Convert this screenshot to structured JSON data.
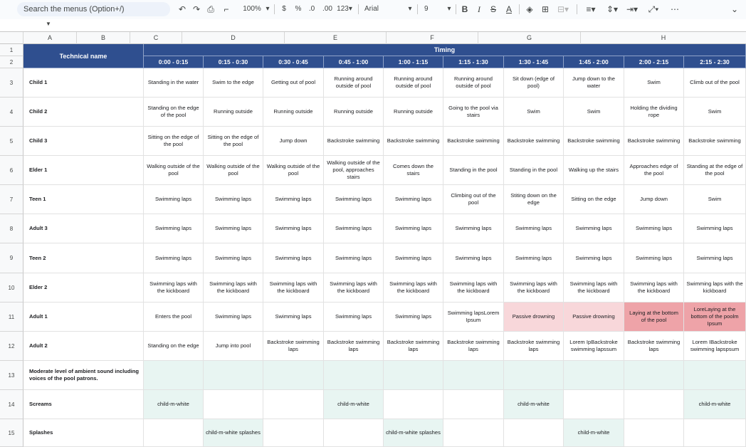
{
  "toolbar": {
    "search_placeholder": "Search the menus (Option+/)",
    "zoom": "100%",
    "currency": "$",
    "percent": "%",
    "dec_decrease": ".0",
    "dec_increase": ".00",
    "format_more": "123",
    "font": "Arial",
    "font_size": "9",
    "bold": "B",
    "italic": "I",
    "strike": "S",
    "text_color": "A",
    "more": "⋯"
  },
  "columns": [
    "A",
    "B",
    "C",
    "D",
    "E",
    "F",
    "G",
    "H"
  ],
  "header": {
    "technical_name": "Technical name",
    "timing": "Timing",
    "times": [
      "0:00 - 0:15",
      "0:15 - 0:30",
      "0:30 - 0:45",
      "0:45 - 1:00",
      "1:00 - 1:15",
      "1:15 - 1:30",
      "1:30 - 1:45",
      "1:45 - 2:00",
      "2:00 - 2:15",
      "2:15 - 2:30"
    ]
  },
  "row_numbers": [
    "1",
    "2",
    "3",
    "4",
    "5",
    "6",
    "7",
    "8",
    "9",
    "10",
    "11",
    "12",
    "13",
    "14",
    "15"
  ],
  "rows": [
    {
      "name": "Child 1",
      "cells": [
        "Standing in the water",
        "Swim to the edge",
        "Getting out of pool",
        "Running around outside of pool",
        "Running around outside of pool",
        "Running around outside of pool",
        "Sit down (edge of pool)",
        "Jump down to the water",
        "Swim",
        "Climb out of the pool"
      ]
    },
    {
      "name": "Child 2",
      "cells": [
        "Standing on the edge of the pool",
        "Running outside",
        "Running outside",
        "Running outside",
        "Running outside",
        "Going to the pool via stairs",
        "Swim",
        "Swim",
        "Holding the dividing rope",
        "Swim"
      ]
    },
    {
      "name": "Child 3",
      "cells": [
        "Sitting on the edge of the pool",
        "Sitting on the edge of the pool",
        "Jump down",
        "Backstroke swimming",
        "Backstroke swimming",
        "Backstroke swimming",
        "Backstroke swimming",
        "Backstroke swimming",
        "Backstroke swimming",
        "Backstroke swimming"
      ]
    },
    {
      "name": "Elder 1",
      "cells": [
        "Walking outside of the pool",
        "Walking outside of the pool",
        "Walking outside of the pool",
        "Walking outside of the pool, approaches stairs",
        "Comes down the stairs",
        "Standing in the pool",
        "Standing in the pool",
        "Walking up the stairs",
        "Approaches edge of the pool",
        "Standing at the edge of the pool"
      ]
    },
    {
      "name": "Teen 1",
      "cells": [
        "Swimming laps",
        "Swimming laps",
        "Swimming laps",
        "Swimming laps",
        "Swimming laps",
        "Climbing out of the pool",
        "Stiting down on the edge",
        "Sitting on the edge",
        "Jump down",
        "Swim"
      ]
    },
    {
      "name": "Adult 3",
      "cells": [
        "Swimming laps",
        "Swimming laps",
        "Swimming laps",
        "Swimming laps",
        "Swimming laps",
        "Swimming laps",
        "Swimming laps",
        "Swimming laps",
        "Swimming laps",
        "Swimming laps"
      ]
    },
    {
      "name": "Teen 2",
      "cells": [
        "Swimming laps",
        "Swimming laps",
        "Swimming laps",
        "Swimming laps",
        "Swimming laps",
        "Swimming laps",
        "Swimming laps",
        "Swimming laps",
        "Swimming laps",
        "Swimming laps"
      ]
    },
    {
      "name": "Elder 2",
      "cells": [
        "Swimming laps with the kickboard",
        "Swimming laps with the kickboard",
        "Swimming laps with the kickboard",
        "Swimming laps with the kickboard",
        "Swimming laps with the kickboard",
        "Swimming laps with the kickboard",
        "Swimming laps with the kickboard",
        "Swimming laps with the kickboard",
        "Swimming laps with the kickboard",
        "Swimming laps with the kickboard"
      ]
    },
    {
      "name": "Adult 1",
      "cells": [
        "Enters the pool",
        "Swimming laps",
        "Swimming laps",
        "Swimming laps",
        "Swimming laps",
        "Swimming lapsLorem Ipsum",
        "Passive drowning",
        "Passive drowning",
        "Laying at the bottom of the pool",
        "LoreLaying at the bottom of the poolm Ipsum"
      ],
      "bg": [
        "",
        "",
        "",
        "",
        "",
        "",
        "#f8d7da",
        "#f8d7da",
        "#eea3a8",
        "#eea3a8"
      ]
    },
    {
      "name": "Adult 2",
      "cells": [
        "Standing on the edge",
        "Jump into pool",
        "Backstroke swimming laps",
        "Backstroke swimming laps",
        "Backstroke swimming laps",
        "Backstroke swimming laps",
        "Backstroke swimming laps",
        "Lorem IpBackstroke swimming lapssum",
        "Backstroke swimming laps",
        "Lorem IBackstroke swimming lapspsum"
      ]
    },
    {
      "name": "Moderate level of ambient sound including voices of the pool patrons.",
      "cells": [
        "",
        "",
        "",
        "",
        "",
        "",
        "",
        "",
        "",
        ""
      ],
      "bg": [
        "#e8f5f2",
        "#e8f5f2",
        "#e8f5f2",
        "#e8f5f2",
        "#e8f5f2",
        "#e8f5f2",
        "#e8f5f2",
        "#e8f5f2",
        "#e8f5f2",
        "#e8f5f2"
      ]
    },
    {
      "name": "Screams",
      "cells": [
        "child-m-white",
        "",
        "",
        "child-m-white",
        "",
        "",
        "child-m-white",
        "",
        "",
        "child-m-white"
      ],
      "bg": [
        "#e8f5f2",
        "",
        "",
        "#e8f5f2",
        "",
        "",
        "#e8f5f2",
        "",
        "",
        "#e8f5f2"
      ]
    },
    {
      "name": "Splashes",
      "cells": [
        "",
        "child-m-white splashes",
        "",
        "",
        "child-m-white splashes",
        "",
        "",
        "child-m-white",
        "",
        ""
      ],
      "bg": [
        "",
        "#e8f5f2",
        "",
        "",
        "#e8f5f2",
        "",
        "",
        "#e8f5f2",
        "",
        ""
      ]
    }
  ]
}
